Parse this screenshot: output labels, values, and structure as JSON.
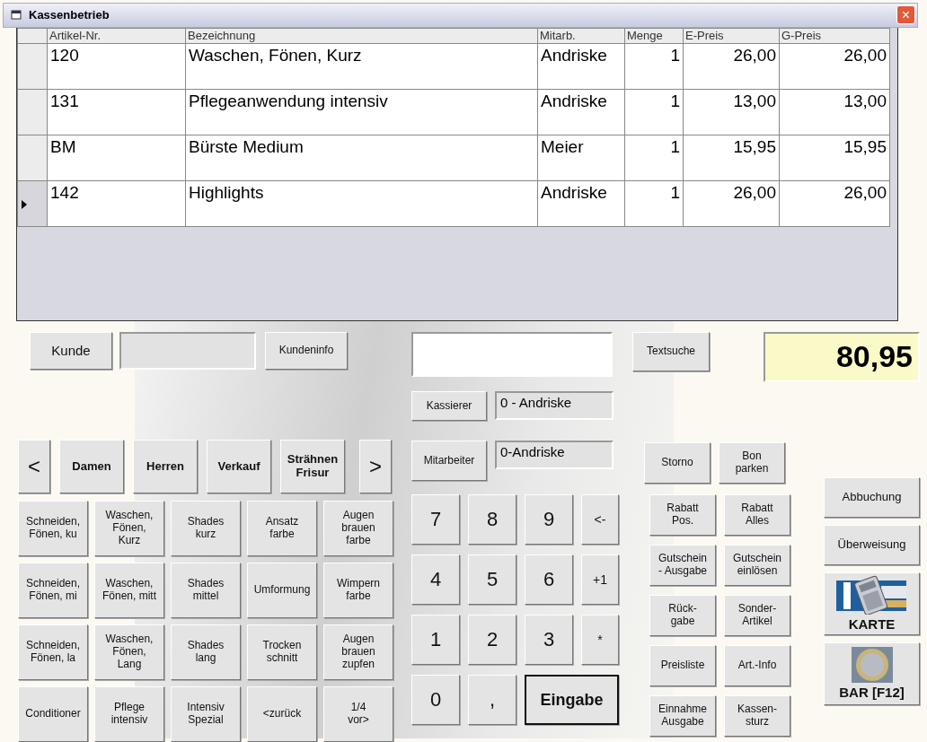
{
  "window": {
    "title": "Kassenbetrieb",
    "close": "×"
  },
  "table": {
    "columns": [
      "Artikel-Nr.",
      "Bezeichnung",
      "Mitarb.",
      "Menge",
      "E-Preis",
      "G-Preis"
    ],
    "rows": [
      {
        "cells": [
          "120",
          "Waschen, Fönen, Kurz",
          "Andriske",
          "1",
          "26,00",
          "26,00"
        ],
        "selected": false
      },
      {
        "cells": [
          "131",
          "Pflegeanwendung intensiv",
          "Andriske",
          "1",
          "13,00",
          "13,00"
        ],
        "selected": false
      },
      {
        "cells": [
          "BM",
          "Bürste Medium",
          "Meier",
          "1",
          "15,95",
          "15,95"
        ],
        "selected": false
      },
      {
        "cells": [
          "142",
          "Highlights",
          "Andriske",
          "1",
          "26,00",
          "26,00"
        ],
        "selected": true
      }
    ]
  },
  "customer": {
    "button": "Kunde",
    "info_button": "Kundeninfo"
  },
  "categories": {
    "prev": "<",
    "next": ">",
    "items": [
      "Damen",
      "Herren",
      "Verkauf",
      "Strähnen\nFrisur"
    ]
  },
  "articles": [
    "Schneiden,\nFönen, ku",
    "Waschen,\nFönen,\nKurz",
    "Shades\nkurz",
    "Ansatz\nfarbe",
    "Augen\nbrauen\nfarbe",
    "Schneiden,\nFönen, mi",
    "Waschen,\nFönen, mitt",
    "Shades\nmittel",
    "Umformung",
    "Wimpern\nfarbe",
    "Schneiden,\nFönen, la",
    "Waschen,\nFönen,\nLang",
    "Shades\nlang",
    "Trocken\nschnitt",
    "Augen\nbrauen\nzupfen",
    "Conditioner",
    "Pflege\nintensiv",
    "Intensiv\nSpezial",
    "<zurück",
    "1/4\nvor>"
  ],
  "search": {
    "button": "Textsuche"
  },
  "cashier": {
    "button": "Kassierer",
    "value": "0 - Andriske"
  },
  "employee": {
    "button": "Mitarbeiter",
    "value": "0-Andriske"
  },
  "keypad": [
    {
      "label": "7",
      "kind": "digit"
    },
    {
      "label": "8",
      "kind": "digit"
    },
    {
      "label": "9",
      "kind": "digit"
    },
    {
      "label": "<-",
      "kind": "function"
    },
    {
      "label": "4",
      "kind": "digit"
    },
    {
      "label": "5",
      "kind": "digit"
    },
    {
      "label": "6",
      "kind": "digit"
    },
    {
      "label": "+1",
      "kind": "function"
    },
    {
      "label": "1",
      "kind": "digit"
    },
    {
      "label": "2",
      "kind": "digit"
    },
    {
      "label": "3",
      "kind": "digit"
    },
    {
      "label": "*",
      "kind": "function"
    },
    {
      "label": "0",
      "kind": "digit"
    },
    {
      "label": ",",
      "kind": "digit"
    },
    {
      "label": "Eingabe",
      "kind": "enter"
    }
  ],
  "actions": [
    "Storno",
    "Bon\nparken",
    "Rabatt\nPos.",
    "Rabatt\nAlles",
    "Gutschein\n- Ausgabe",
    "Gutschein\neinlösen",
    "Rück-\ngabe",
    "Sonder-\nArtikel",
    "Preisliste",
    "Art.-Info",
    "Einnahme\nAusgabe",
    "Kassen-\nsturz"
  ],
  "total": "80,95",
  "payments": [
    {
      "label": "Abbuchung",
      "kind": "text"
    },
    {
      "label": "Überweisung",
      "kind": "text"
    },
    {
      "label": "KARTE",
      "kind": "card"
    },
    {
      "label": "BAR [F12]",
      "kind": "cash"
    }
  ]
}
